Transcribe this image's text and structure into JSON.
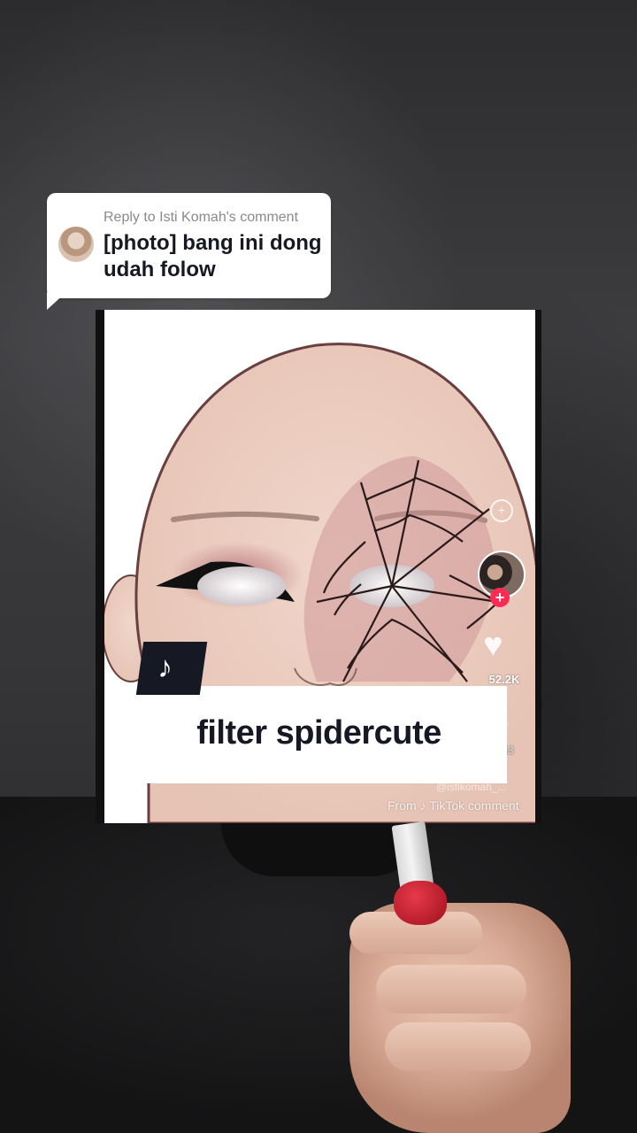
{
  "comment_bubble": {
    "reply_label": "Reply to Isti Komah's comment",
    "message": "[photo] bang ini dong udah folow",
    "avatar_icon": "user-avatar-icon"
  },
  "embedded_post": {
    "caption": "filter spidercute",
    "tiktok_badge_icon": "tiktok-logo-icon",
    "likes": "52.2K",
    "comments": "163",
    "watermark": "From ♪ TikTok comment",
    "username_watermark": "@istikomah_..."
  },
  "colors": {
    "bubble_bg": "#ffffff",
    "caption_text": "#161823",
    "follow_plus": "#fe2c55"
  }
}
